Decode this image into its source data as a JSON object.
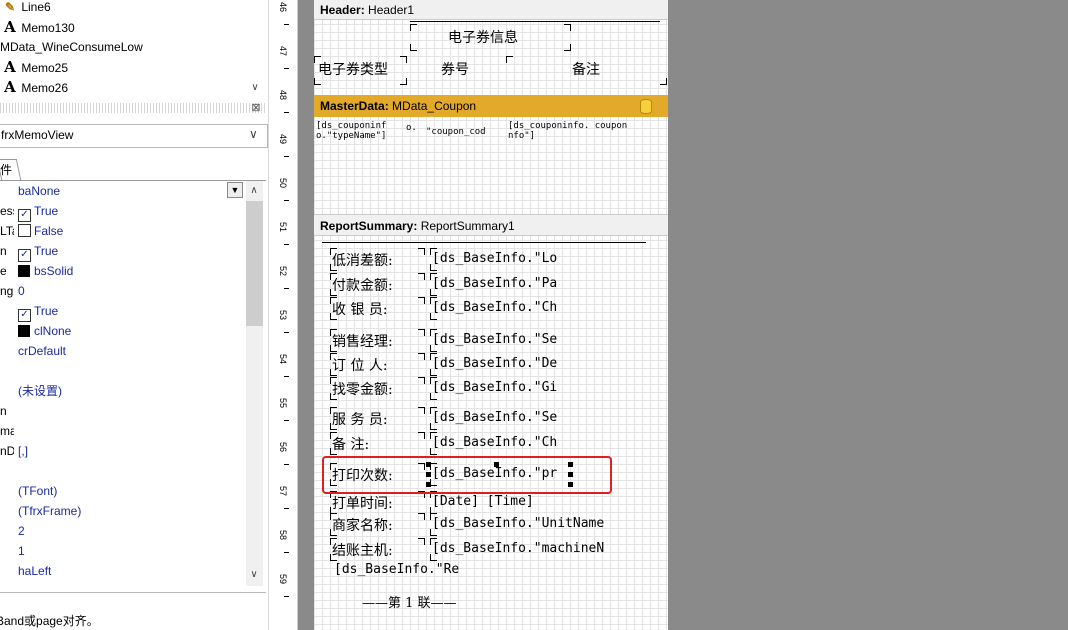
{
  "left_panel": {
    "tree_items": [
      {
        "icon": "pencil-icon",
        "label": "Line6"
      },
      {
        "icon": "text-memo-icon",
        "label": "Memo130"
      },
      {
        "icon": "",
        "label": "MData_WineConsumeLow"
      },
      {
        "icon": "text-memo-icon",
        "label": "Memo25"
      },
      {
        "icon": "text-memo-icon",
        "label": "Memo26"
      }
    ],
    "object_combo": "frxMemoView",
    "tab_label": "件",
    "properties": [
      {
        "name": "",
        "value": "baNone",
        "kind": "dropdown"
      },
      {
        "name": "ess",
        "value": "True",
        "kind": "check",
        "checked": true
      },
      {
        "name": "LTa",
        "value": "False",
        "kind": "check",
        "checked": false
      },
      {
        "name": "n",
        "value": "True",
        "kind": "check",
        "checked": true
      },
      {
        "name": "e",
        "value": "bsSolid",
        "kind": "swatch"
      },
      {
        "name": "ng",
        "value": "0",
        "kind": "text"
      },
      {
        "name": "",
        "value": "True",
        "kind": "check",
        "checked": true
      },
      {
        "name": "",
        "value": "clNone",
        "kind": "swatch"
      },
      {
        "name": "",
        "value": "crDefault",
        "kind": "text"
      },
      {
        "name": "",
        "value": "",
        "kind": "text"
      },
      {
        "name": "",
        "value": "(未设置)",
        "kind": "text"
      },
      {
        "name": "n",
        "value": "",
        "kind": "text"
      },
      {
        "name": "ma",
        "value": "",
        "kind": "text"
      },
      {
        "name": "nDe",
        "value": "[,]",
        "kind": "text"
      },
      {
        "name": "",
        "value": "",
        "kind": "text"
      },
      {
        "name": "",
        "value": "(TFont)",
        "kind": "text"
      },
      {
        "name": "",
        "value": "(TfrxFrame)",
        "kind": "text"
      },
      {
        "name": "",
        "value": "2",
        "kind": "text"
      },
      {
        "name": "",
        "value": "1",
        "kind": "text"
      },
      {
        "name": "",
        "value": "haLeft",
        "kind": "text"
      }
    ],
    "description": "Band或page对齐。"
  },
  "ruler": {
    "numbers": [
      "46",
      "47",
      "48",
      "49",
      "50",
      "51",
      "52",
      "53",
      "54",
      "55",
      "56",
      "57",
      "58",
      "59"
    ]
  },
  "bands": {
    "header": {
      "kind": "Header:",
      "name": "Header1"
    },
    "header_title": "电子券信息",
    "header_cols": [
      "电子券类型",
      "券号",
      "备注"
    ],
    "masterdata": {
      "kind": "MasterData:",
      "name": "MData_Coupon"
    },
    "master_cells": [
      "[ds_CouponInfo.\"typeName\"]",
      "o.\"coupon_cod",
      "[ds_CouponInfo. couponInfo\"]"
    ],
    "master_cell_lines": {
      "c1a": "[ds_couponinf",
      "c1b": "o.\"typeName\"]",
      "c2a": "o.",
      "c2b": "\"coupon_cod",
      "c3a": "[ds_couponinfo. coupon",
      "c3b": "nfo\"]"
    },
    "summary": {
      "kind": "ReportSummary:",
      "name": "ReportSummary1"
    },
    "summary_rows": [
      {
        "label": "低消差额:",
        "value": "[ds_BaseInfo.\"Lo"
      },
      {
        "label": "付款金额:",
        "value": "[ds_BaseInfo.\"Pa"
      },
      {
        "label": "收 银 员:",
        "value": "[ds_BaseInfo.\"Ch"
      },
      {
        "label": "销售经理:",
        "value": "[ds_BaseInfo.\"Se"
      },
      {
        "label": "订 位 人:",
        "value": "[ds_BaseInfo.\"De"
      },
      {
        "label": "找零金额:",
        "value": "[ds_BaseInfo.\"Gi"
      },
      {
        "label": "服 务 员:",
        "value": "[ds_BaseInfo.\"Se"
      },
      {
        "label": "备    注:",
        "value": "[ds_BaseInfo.\"Ch"
      },
      {
        "label": "打印次数:",
        "value": "[ds_BaseInfo.\"pr"
      },
      {
        "label": "打单时间:",
        "value": "[Date] [Time]"
      },
      {
        "label": "商家名称:",
        "value": "[ds_BaseInfo.\"UnitName"
      },
      {
        "label": "结账主机:",
        "value": "[ds_BaseInfo.\"machineN"
      }
    ],
    "last_line": "[ds_BaseInfo.\"Re",
    "footer_line": "——第  1  联——"
  },
  "colors": {
    "masterdata_band": "#e2a92a",
    "highlight_box": "#e02020",
    "dark_gray": "#8a8a8a"
  }
}
